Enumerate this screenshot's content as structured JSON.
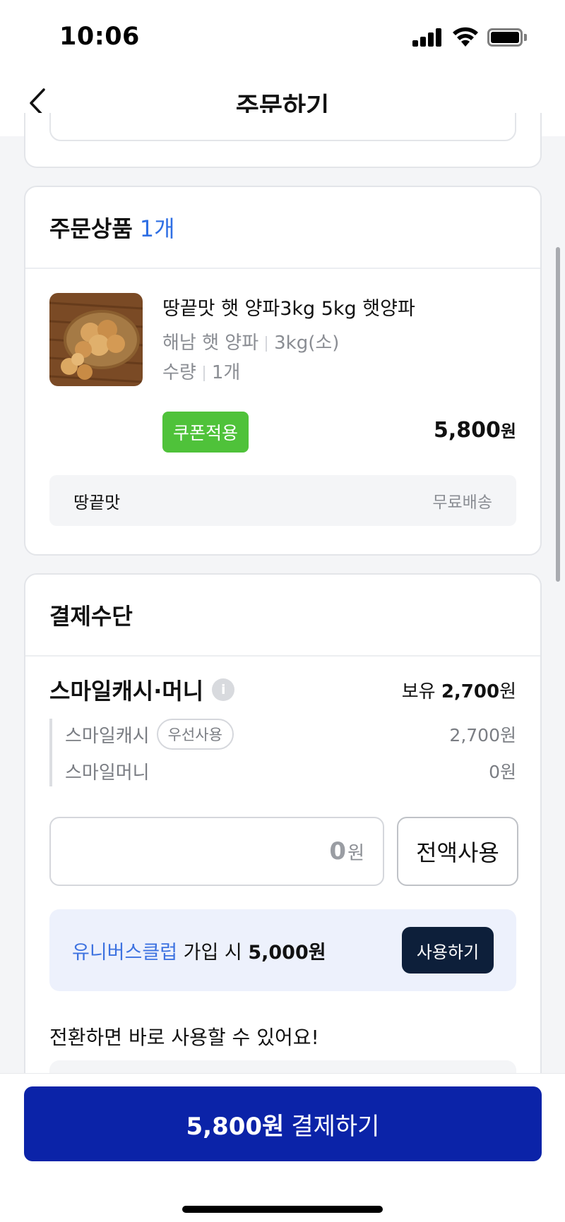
{
  "status_bar": {
    "time": "10:06"
  },
  "header": {
    "title": "주문하기",
    "back_icon": "chevron-left-icon"
  },
  "order_products": {
    "title": "주문상품",
    "count": "1개",
    "product": {
      "name": "땅끝맛 햇 양파3kg 5kg 햇양파",
      "option_name": "해남 햇 양파",
      "option_value": "3kg(소)",
      "qty_label": "수량",
      "qty_value": "1개",
      "coupon_label": "쿠폰적용",
      "price": "5,800",
      "price_unit": "원"
    },
    "seller": "땅끝맛",
    "shipping": "무료배송"
  },
  "payment": {
    "title": "결제수단",
    "smile_title": "스마일캐시·머니",
    "holding_label": "보유",
    "holding_amount": "2,700",
    "holding_unit": "원",
    "cash_label": "스마일캐시",
    "cash_badge": "우선사용",
    "cash_value": "2,700원",
    "money_label": "스마일머니",
    "money_value": "0원",
    "input_value": "0",
    "input_unit": "원",
    "full_use_label": "전액사용",
    "promo_link": "유니버스클럽",
    "promo_mid": " 가입 시 ",
    "promo_amount": "5,000원",
    "promo_button": "사용하기",
    "convert_note": "전환하면 바로 사용할 수 있어요!"
  },
  "bottom": {
    "pay_amount": "5,800원",
    "pay_label": "결제하기"
  },
  "colors": {
    "accent_blue": "#2f6fe4",
    "coupon_green": "#4fc23a",
    "pay_navy": "#0b23a8",
    "use_btn_dark": "#0d1f3a"
  }
}
